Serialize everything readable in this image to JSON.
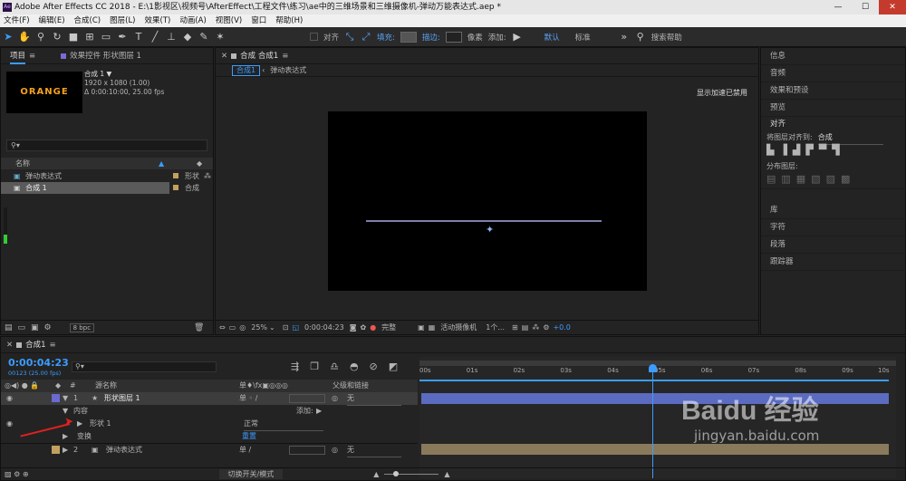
{
  "titlebar": {
    "title": "Adobe After Effects CC 2018 - E:\\1影视区\\视频号\\AfterEffect\\工程文件\\练习\\ae中的三维场景和三维摄像机-弹动万能表达式.aep *",
    "logo": "Ae",
    "minimize": "—",
    "maximize": "☐",
    "close": "✕"
  },
  "menu": [
    "文件(F)",
    "编辑(E)",
    "合成(C)",
    "图层(L)",
    "效果(T)",
    "动画(A)",
    "视图(V)",
    "窗口",
    "帮助(H)"
  ],
  "toolbar": {
    "align_label": "对齐",
    "fill_label": "填充:",
    "stroke_label": "描边:",
    "stroke_px": "像素",
    "add_label": "添加:",
    "workspace_default": "默认",
    "workspace_standard": "标准",
    "search_placeholder": "搜索帮助"
  },
  "project_panel": {
    "tab_project": "项目",
    "tab_effects": "效果控件 形状图层 1",
    "thumb_text": "ORANGE",
    "comp_name": "合成 1 ▼",
    "comp_res": "1920 x 1080 (1.00)",
    "comp_dur": "Δ 0:00:10:00, 25.00 fps",
    "col_name": "名称",
    "items": [
      {
        "name": "弹动表达式",
        "type": "形状"
      },
      {
        "name": "合成 1",
        "type": "合成"
      }
    ],
    "bpc": "8 bpc"
  },
  "viewer": {
    "tab_label": "合成 合成1",
    "breadcrumb_comp": "合成1",
    "breadcrumb_layer": "弹动表达式",
    "accel_note": "显示加速已禁用",
    "zoom": "25%",
    "timecode": "0:00:04:23",
    "quality": "完整",
    "camera": "活动摄像机",
    "views": "1个...",
    "exposure": "+0.0"
  },
  "right_panel": {
    "items": [
      "信息",
      "音频",
      "效果和预设",
      "预览"
    ],
    "align_title": "对齐",
    "align_to_label": "将图层对齐到:",
    "align_to_value": "合成",
    "distribute_label": "分布图层:",
    "items2": [
      "库",
      "字符",
      "段落",
      "跟踪器"
    ]
  },
  "timeline": {
    "tab": "合成1",
    "timecode": "0:00:04:23",
    "frames": "00123 (25.00 fps)",
    "search_placeholder": "",
    "col_source": "源名称",
    "col_switches": "单♦\\fx▣◎◎◎",
    "col_parent": "父级和链接",
    "layers": [
      {
        "index": "1",
        "name": "形状图层 1",
        "parent": "无"
      },
      {
        "index": "2",
        "name": "弹动表达式",
        "parent": "无"
      }
    ],
    "content_label": "内容",
    "add_label": "添加:",
    "shape_label": "形状 1",
    "blend_mode": "正常",
    "transform_label": "变换",
    "reset_label": "重置",
    "toggle_label": "切换开关/模式",
    "ruler": [
      "00s",
      "01s",
      "02s",
      "03s",
      "04s",
      "05s",
      "06s",
      "07s",
      "08s",
      "09s",
      "10s"
    ],
    "playhead_seconds": 4.92,
    "duration_seconds": 10
  },
  "watermark": {
    "brand": "Baidu 经验",
    "url": "jingyan.baidu.com"
  },
  "colors": {
    "accent": "#3b9cff",
    "layer1_bar": "#5b6bc0",
    "layer2_bar": "#8a7a5c",
    "orange": "#f5a11b"
  }
}
